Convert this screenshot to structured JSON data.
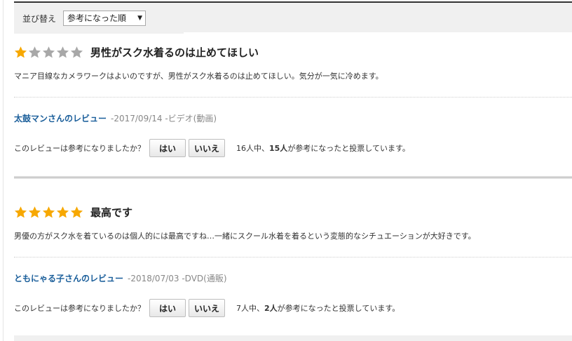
{
  "sort": {
    "label": "並び替え",
    "selected": "参考になった順"
  },
  "colors": {
    "star_filled": "#f7a800",
    "star_empty": "#a8a8a8",
    "author_link": "#1a5e9a"
  },
  "reviews": [
    {
      "rating": 1,
      "max_rating": 5,
      "title": "男性がスク水着るのは止めてほしい",
      "body": "マニア目線なカメラワークはよいのですが、男性がスク水着るのは止めてほしい。気分が一気に冷めます。",
      "author": "太鼓マンさんのレビュー",
      "date": "-2017/09/14",
      "format": " -ビデオ(動画)",
      "question": "このレビューは参考になりましたか？",
      "yes_label": "はい",
      "no_label": "いいえ",
      "tally_total": "16人中、",
      "tally_helpful": "15人",
      "tally_suffix": "が参考になったと投票しています。"
    },
    {
      "rating": 5,
      "max_rating": 5,
      "title": "最高です",
      "body": "男優の方がスク水を着ているのは個人的には最高ですね…一緒にスクール水着を着るという変態的なシチュエーションが大好きです。",
      "author": "ともにゃる子さんのレビュー",
      "date": "-2018/07/03",
      "format": " -DVD(通販)",
      "question": "このレビューは参考になりましたか？",
      "yes_label": "はい",
      "no_label": "いいえ",
      "tally_total": "7人中、",
      "tally_helpful": "2人",
      "tally_suffix": "が参考になったと投票しています。"
    }
  ]
}
